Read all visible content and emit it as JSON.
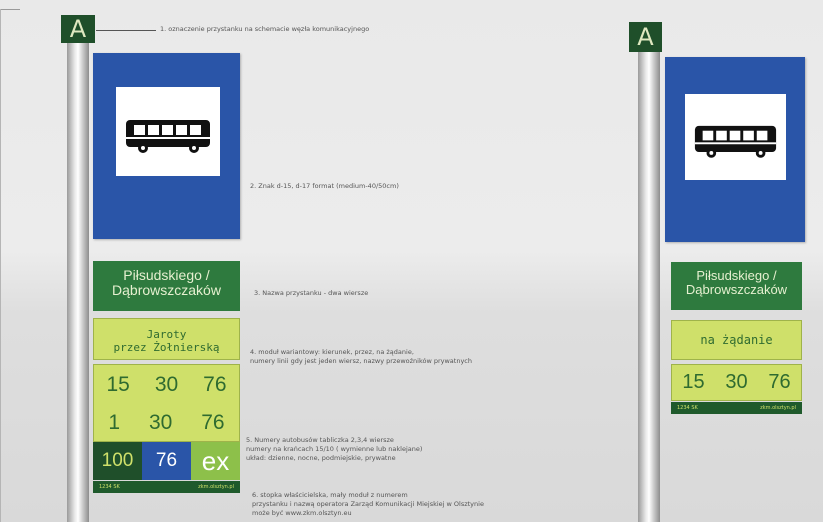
{
  "colors": {
    "sign_blue": "#2a55a8",
    "module_green": "#2e7a3e",
    "module_lime": "#cfe06a",
    "dark_green": "#1f4f2a",
    "blue_cell": "#2a55a8",
    "lime_cell": "#8dc04a"
  },
  "icons": {
    "bus": "bus-icon"
  },
  "left_stop": {
    "letter": "A",
    "name_line1": "Piłsudskiego /",
    "name_line2": "Dąbrowszczaków",
    "variant_line1": "Jaroty",
    "variant_line2": "przez Żołnierską",
    "row1": [
      "15",
      "30",
      "76"
    ],
    "row2": [
      "1",
      "30",
      "76"
    ],
    "row3": [
      "100",
      "76",
      "ex"
    ],
    "foot_left": "1234 SK",
    "foot_right": "zkm.olsztyn.pl"
  },
  "right_stop": {
    "letter": "A",
    "name_line1": "Piłsudskiego /",
    "name_line2": "Dąbrowszczaków",
    "variant": "na żądanie",
    "row1": [
      "15",
      "30",
      "76"
    ],
    "foot_left": "1234 SK",
    "foot_right": "zkm.olsztyn.pl"
  },
  "notes": {
    "n1": "1. oznaczenie przystanku na schemacie węzła komunikacyjnego",
    "n2": "2. Znak d-15, d-17 format (medium-40/50cm)",
    "n3": "3. Nazwa przystanku - dwa wiersze",
    "n4_l1": "4. moduł wariantowy: kierunek, przez, na żądanie,",
    "n4_l2": "numery linii gdy jest jeden wiersz, nazwy przewoźników prywatnych",
    "n5_l1": "5. Numery autobusów tabliczka 2,3,4 wiersze",
    "n5_l2": "numery na krańcach 15/10 ( wymienne lub naklejane)",
    "n5_l3": "układ: dzienne, nocne, podmiejskie, prywatne",
    "n6_l1": "6. stopka właścicielska, mały moduł z numerem",
    "n6_l2": "przystanku i nazwą operatora Zarząd Komunikacji Miejskiej w Olsztynie",
    "n6_l3": "może być www.zkm.olsztyn.eu"
  }
}
